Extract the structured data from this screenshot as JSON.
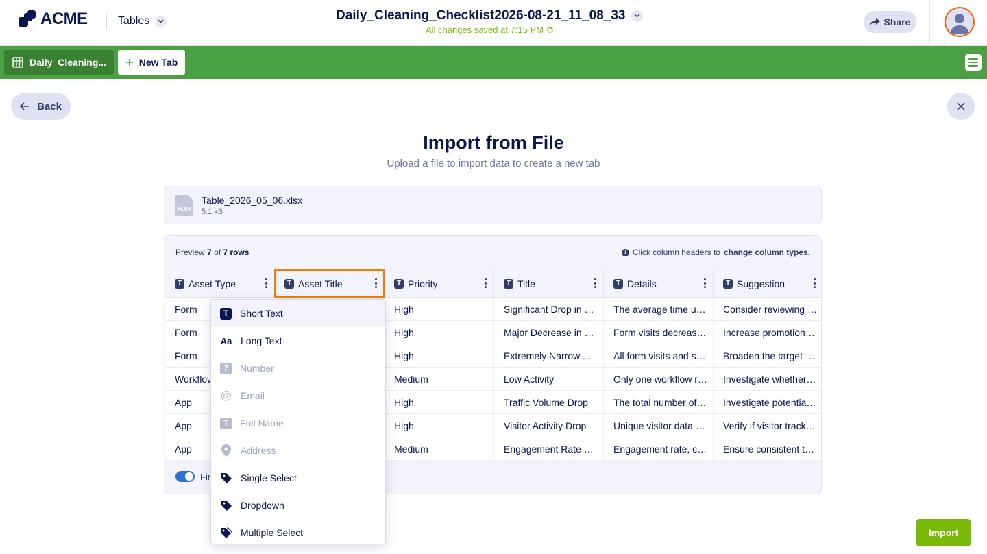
{
  "header": {
    "logo_text": "ACME",
    "product_menu": "Tables",
    "document_title": "Daily_Cleaning_Checklist2026-08-21_11_08_33",
    "saved_status": "All changes saved at 7:15 PM",
    "share_label": "Share"
  },
  "tabs": {
    "active_tab_label": "Daily_Cleaning...",
    "new_tab_label": "New Tab"
  },
  "page": {
    "back_label": "Back",
    "title": "Import from File",
    "subtitle": "Upload a file to import data to create a new tab"
  },
  "file": {
    "icon_label": "XLSX",
    "name": "Table_2026_05_06.xlsx",
    "size": "5.1 kB"
  },
  "preview": {
    "count_prefix": "Preview",
    "count_shown": "7",
    "count_of": "of",
    "count_total": "7 rows",
    "hint_prefix": "Click column headers to",
    "hint_bold": "change column types.",
    "first_row_label": "Fir"
  },
  "table": {
    "columns": [
      "Asset Type",
      "Asset Title",
      "Priority",
      "Title",
      "Details",
      "Suggestion"
    ],
    "rows": [
      [
        "Form",
        "",
        "High",
        "Significant Drop in Form Views",
        "The average time users spend on the form",
        "Consider reviewing the form flow"
      ],
      [
        "Form",
        "",
        "High",
        "Major Decrease in Submissions",
        "Form visits decreased significantly",
        "Increase promotion of the form"
      ],
      [
        "Form",
        "",
        "High",
        "Extremely Narrow Audience",
        "All form visits and submissions came from one source",
        "Broaden the target audience"
      ],
      [
        "Workflow",
        "",
        "Medium",
        "Low Activity",
        "Only one workflow run in the period",
        "Investigate whether the workflow is triggered"
      ],
      [
        "App",
        "",
        "High",
        "Traffic Volume Drop",
        "The total number of app visits dropped",
        "Investigate potential causes"
      ],
      [
        "App",
        "",
        "High",
        "Visitor Activity Drop",
        "Unique visitor data decreased",
        "Verify if visitor tracking is working"
      ],
      [
        "App",
        "",
        "Medium",
        "Engagement Rate Decline",
        "Engagement rate, compared to last period",
        "Ensure consistent tracking"
      ]
    ]
  },
  "type_menu": {
    "items": [
      {
        "label": "Short Text",
        "icon": "T",
        "state": "active"
      },
      {
        "label": "Long Text",
        "icon": "Aa",
        "state": "enabled"
      },
      {
        "label": "Number",
        "icon": "7",
        "state": "disabled"
      },
      {
        "label": "Email",
        "icon": "@",
        "state": "disabled"
      },
      {
        "label": "Full Name",
        "icon": "T",
        "state": "disabled"
      },
      {
        "label": "Address",
        "icon": "pin",
        "state": "disabled"
      },
      {
        "label": "Single Select",
        "icon": "tag",
        "state": "enabled"
      },
      {
        "label": "Dropdown",
        "icon": "tag",
        "state": "enabled"
      },
      {
        "label": "Multiple Select",
        "icon": "tags",
        "state": "enabled"
      }
    ]
  },
  "footer": {
    "import_label": "Import"
  },
  "colors": {
    "brand_navy": "#0a1551",
    "tabbar_green": "#4ba043",
    "import_green": "#78bb07",
    "highlight_orange": "#f57c00"
  }
}
